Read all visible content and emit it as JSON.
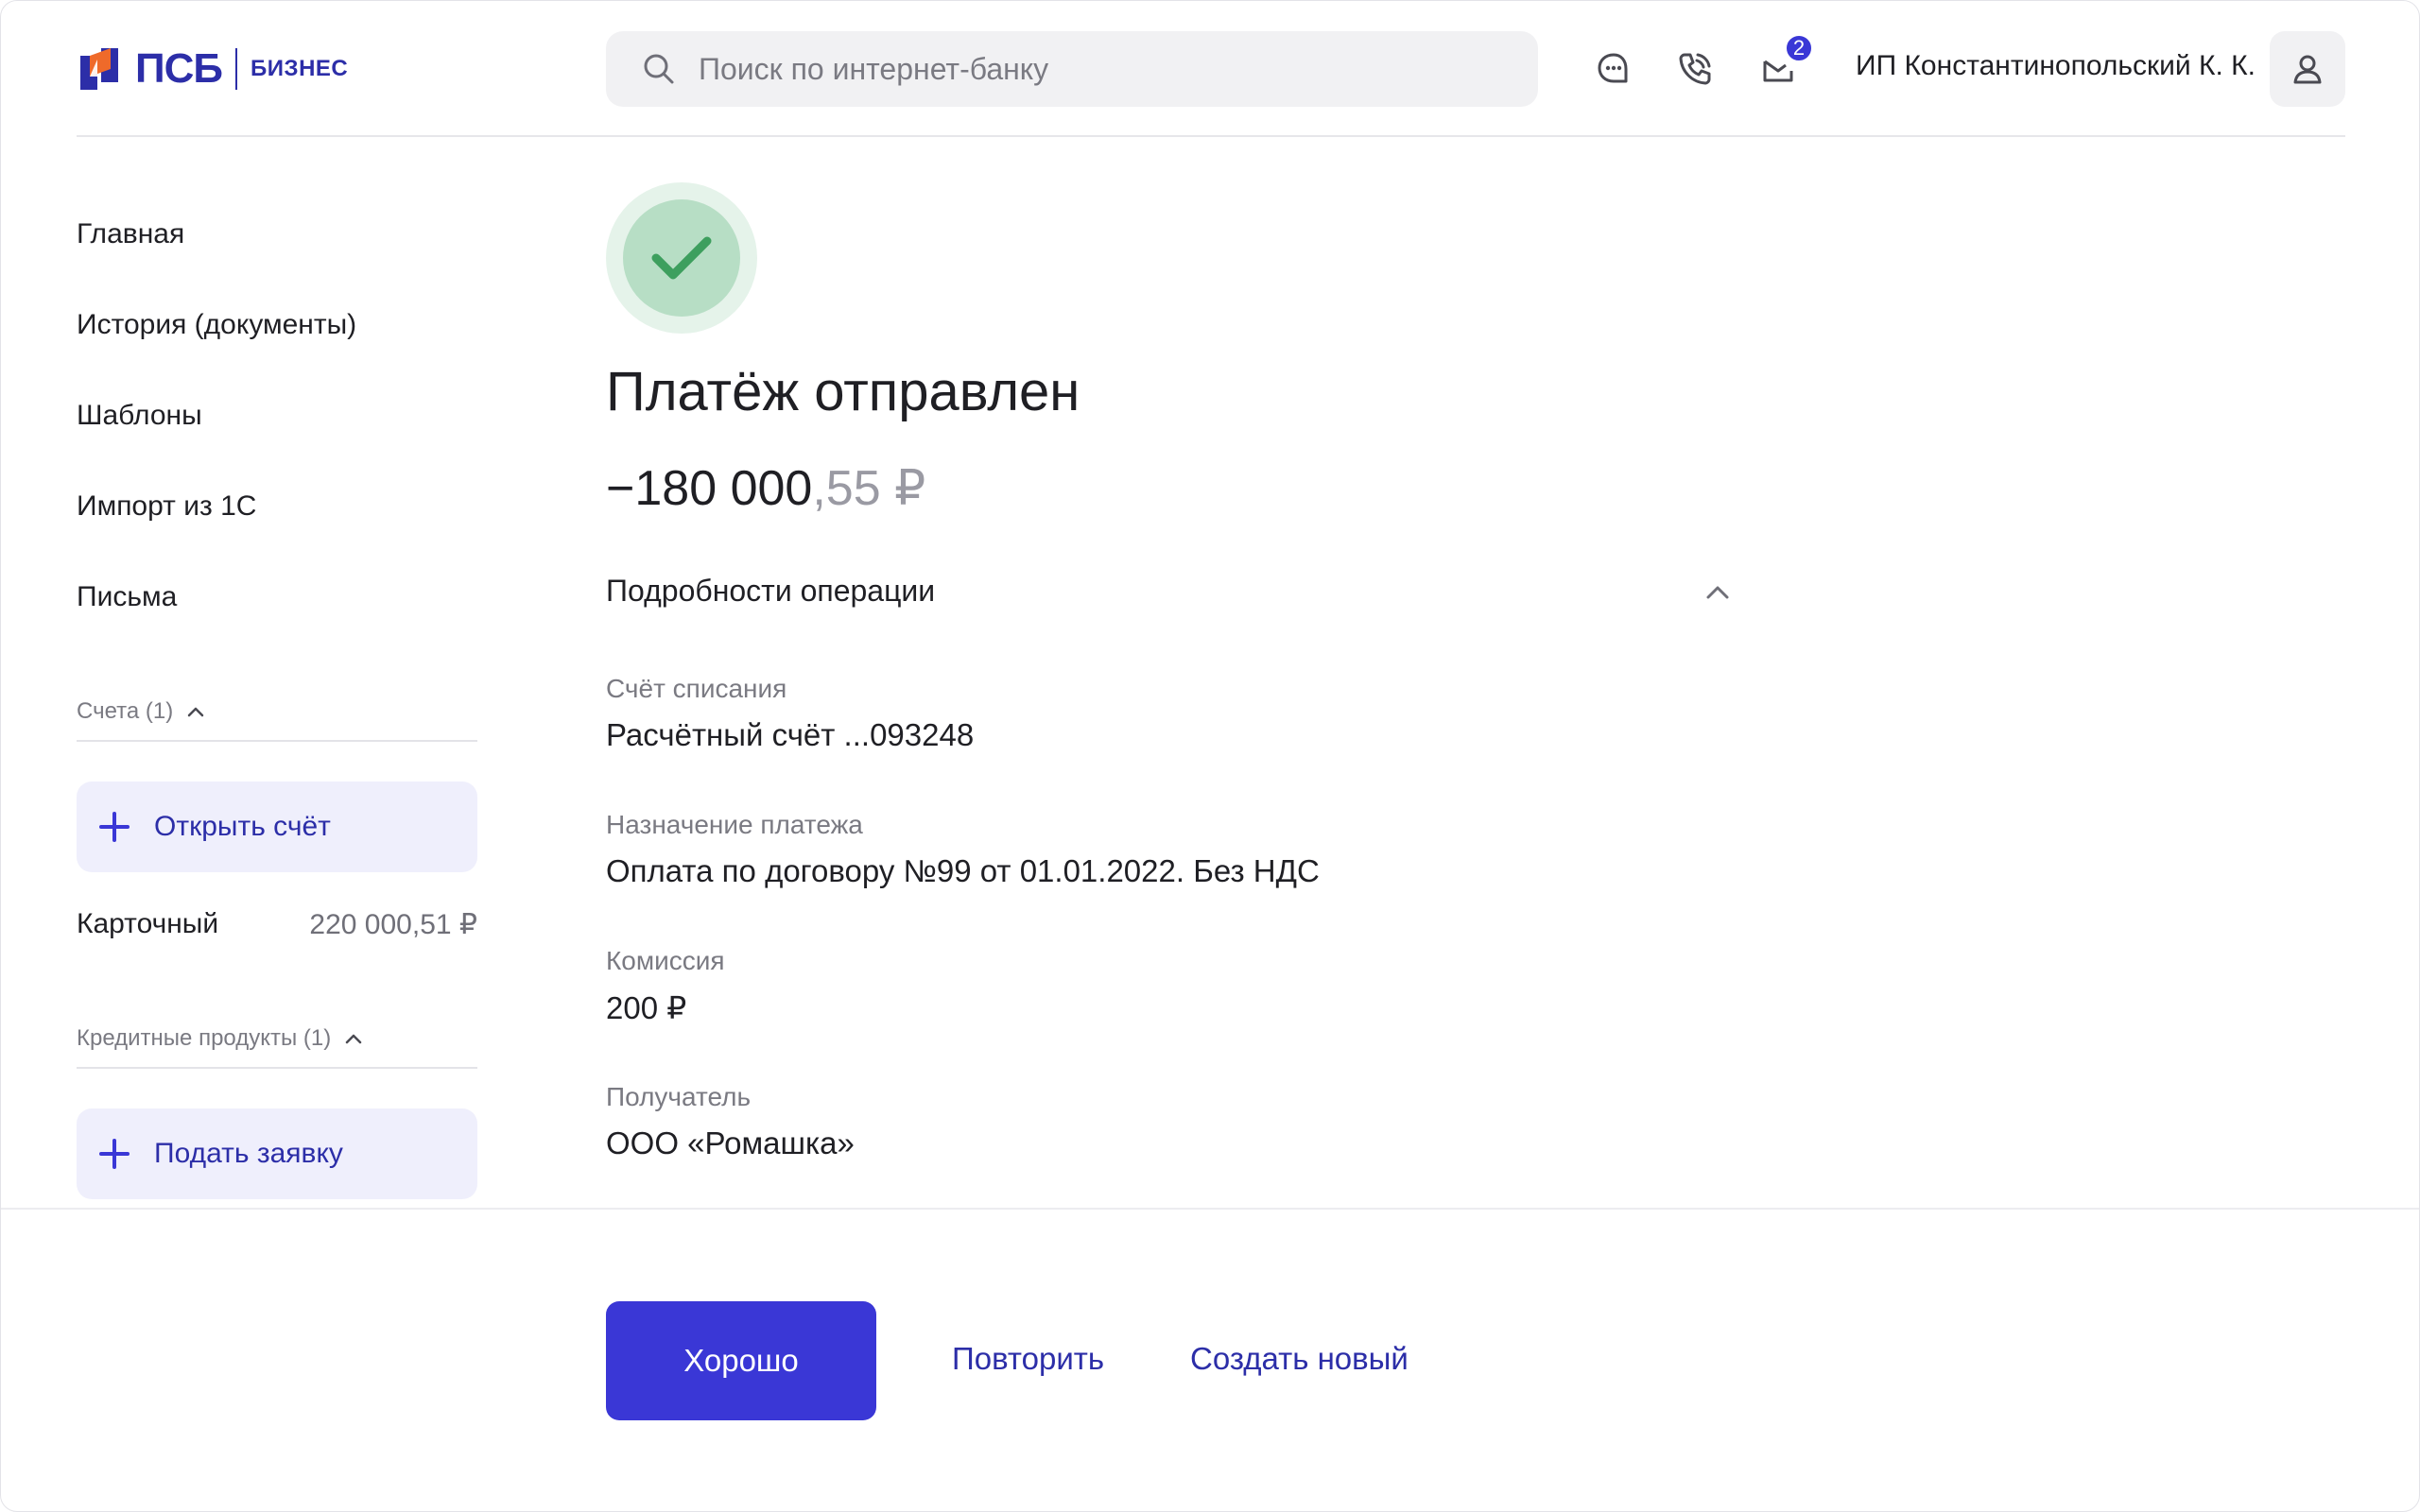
{
  "header": {
    "logo": {
      "brand": "ПСБ",
      "subtitle": "БИЗНЕС",
      "colors": {
        "orange": "#ef6a2a",
        "blue": "#2c2ea8"
      }
    },
    "search": {
      "placeholder": "Поиск по интернет-банку",
      "value": "",
      "icon": "search-icon"
    },
    "icons": [
      "chat-icon",
      "phone-icon",
      "mail-icon"
    ],
    "mail_badge": "2",
    "user_name": "ИП Константинопольский К. К.",
    "avatar_icon": "user-icon"
  },
  "sidebar": {
    "nav": [
      {
        "label": "Главная"
      },
      {
        "label": "История (документы)"
      },
      {
        "label": "Шаблоны"
      },
      {
        "label": "Импорт из 1С"
      },
      {
        "label": "Письма"
      }
    ],
    "accounts": {
      "title": "Счета (1)",
      "open_button": "Открыть счёт",
      "items": [
        {
          "name": "Карточный",
          "amount": "220 000,51 ₽"
        }
      ]
    },
    "credit": {
      "title": "Кредитные продукты (1)",
      "apply_button": "Подать заявку"
    }
  },
  "main": {
    "status_icon": "check-icon",
    "title": "Платёж отправлен",
    "amount_whole": "−180 000",
    "amount_fraction": ",55 ₽",
    "details_title": "Подробности операции",
    "fields": [
      {
        "label": "Счёт списания",
        "value": "Расчётный счёт ...093248"
      },
      {
        "label": "Назначение платежа",
        "value": "Оплата по договору №99 от 01.01.2022. Без НДС"
      },
      {
        "label": "Комиссия",
        "value": "200 ₽"
      },
      {
        "label": "Получатель",
        "value": "ООО «Ромашка»"
      }
    ]
  },
  "footer": {
    "ok_button": "Хорошо",
    "repeat_link": "Повторить",
    "create_link": "Создать новый"
  },
  "colors": {
    "accent": "#3a37d6",
    "success": "#3d9f5e",
    "success_bg": "#b7dec5"
  }
}
